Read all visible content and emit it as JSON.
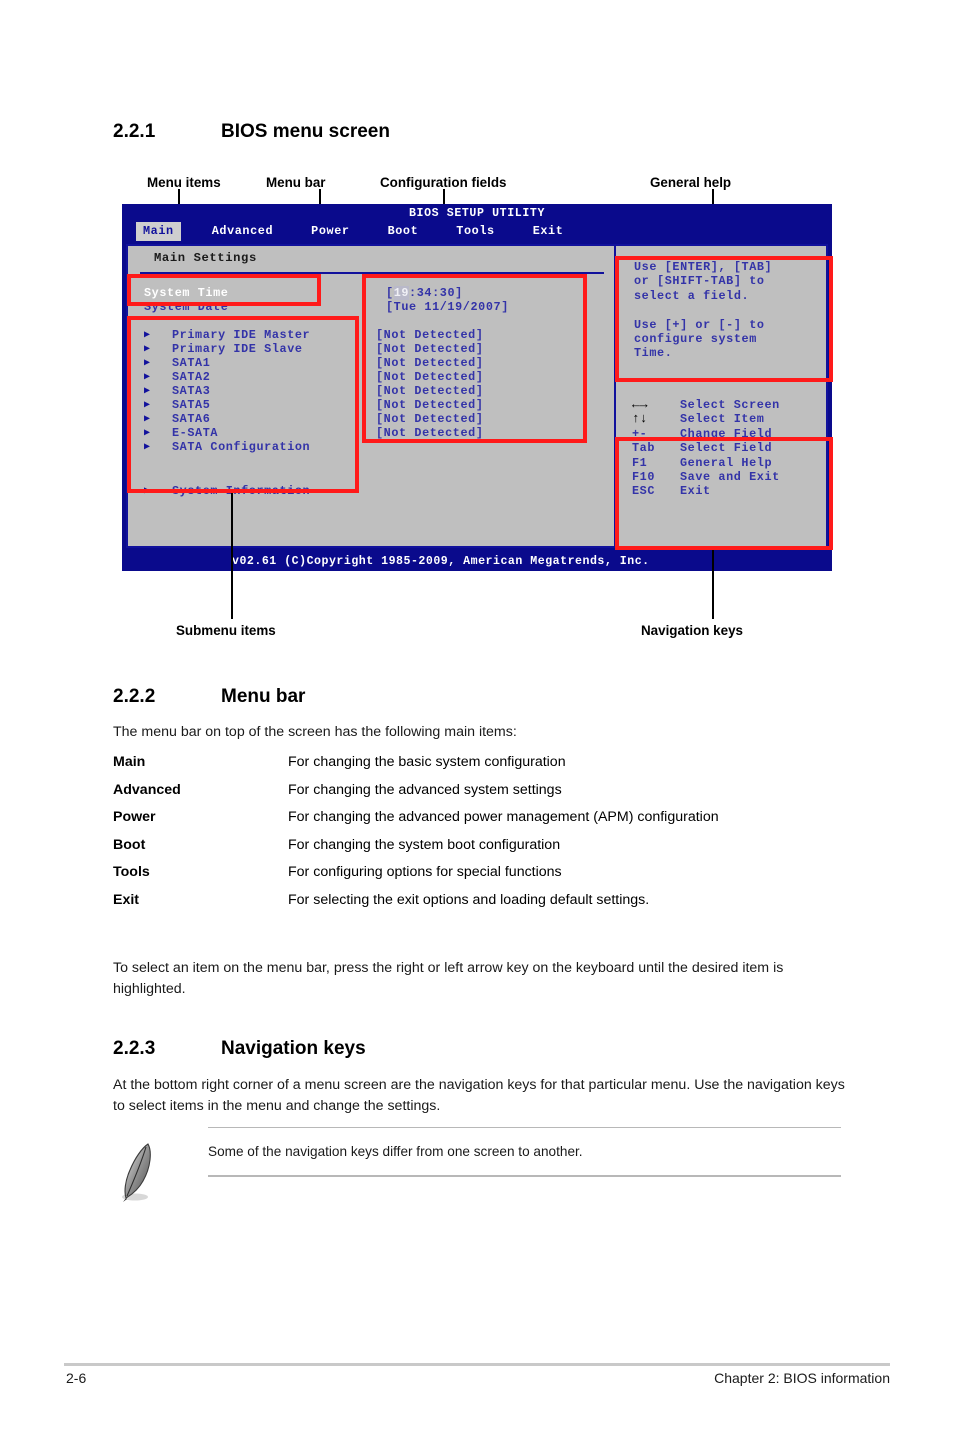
{
  "section_1": {
    "number": "2.2.1",
    "title": "BIOS menu screen"
  },
  "figure": {
    "callouts": {
      "menu_items": "Menu items",
      "menu_bar": "Menu bar",
      "configuration_fields": "Configuration fields",
      "general_help": "General help",
      "submenu_items": "Submenu items",
      "navigation_keys": "Navigation keys"
    },
    "bios": {
      "title": "BIOS SETUP UTILITY",
      "tabs": [
        {
          "label": "Main",
          "active": true
        },
        {
          "label": "Advanced",
          "active": false
        },
        {
          "label": "Power",
          "active": false
        },
        {
          "label": "Boot",
          "active": false
        },
        {
          "label": "Tools",
          "active": false
        },
        {
          "label": "Exit",
          "active": false
        }
      ],
      "settings_title": "Main Settings",
      "rows": [
        {
          "label": "System Time",
          "value_prefix": "[",
          "value_hl": "19",
          "value_suffix": ":34:30]",
          "selected": true,
          "submenu": false
        },
        {
          "label": "System Date",
          "value": "[Tue 11/19/2007]",
          "selected": false,
          "submenu": false
        },
        {
          "label": "Primary IDE Master",
          "value": "[Not Detected]",
          "selected": false,
          "submenu": true
        },
        {
          "label": "Primary IDE Slave",
          "value": "[Not Detected]",
          "selected": false,
          "submenu": true
        },
        {
          "label": "SATA1",
          "value": "[Not Detected]",
          "selected": false,
          "submenu": true
        },
        {
          "label": "SATA2",
          "value": "[Not Detected]",
          "selected": false,
          "submenu": true
        },
        {
          "label": "SATA3",
          "value": "[Not Detected]",
          "selected": false,
          "submenu": true
        },
        {
          "label": "SATA5",
          "value": "[Not Detected]",
          "selected": false,
          "submenu": true
        },
        {
          "label": "SATA6",
          "value": "[Not Detected]",
          "selected": false,
          "submenu": true
        },
        {
          "label": "E-SATA",
          "value": "[Not Detected]",
          "selected": false,
          "submenu": true
        },
        {
          "label": "SATA Configuration",
          "value": "",
          "selected": false,
          "submenu": true
        },
        {
          "label": "System Information",
          "value": "",
          "selected": false,
          "submenu": true
        }
      ],
      "help_text": "Use [ENTER], [TAB]\nor [SHIFT-TAB] to\nselect a field.\n\nUse [+] or [-] to\nconfigure system\nTime.",
      "nav_keys": [
        {
          "key": "←→",
          "glyph": true,
          "desc": "Select Screen"
        },
        {
          "key": "↑↓",
          "glyph": true,
          "desc": "Select Item"
        },
        {
          "key": "+-",
          "glyph": false,
          "desc": "Change Field"
        },
        {
          "key": "Tab",
          "glyph": false,
          "desc": "Select Field"
        },
        {
          "key": "F1",
          "glyph": false,
          "desc": "General Help"
        },
        {
          "key": "F10",
          "glyph": false,
          "desc": "Save and Exit"
        },
        {
          "key": "ESC",
          "glyph": false,
          "desc": "Exit"
        }
      ],
      "footer": "v02.61 (C)Copyright 1985-2009, American Megatrends, Inc."
    }
  },
  "section_2": {
    "number": "2.2.2",
    "title": "Menu bar",
    "intro": "The menu bar on top of the screen has the following main items:",
    "items": [
      {
        "term": "Main",
        "desc": "For changing the basic system configuration"
      },
      {
        "term": "Advanced",
        "desc": "For changing the advanced system settings"
      },
      {
        "term": "Power",
        "desc": "For changing the advanced power management (APM) configuration"
      },
      {
        "term": "Boot",
        "desc": "For changing the system boot configuration"
      },
      {
        "term": "Tools",
        "desc": "For configuring options for special functions"
      },
      {
        "term": "Exit",
        "desc": "For selecting the exit options and loading default settings."
      }
    ],
    "outro": "To select an item on the menu bar, press the right or left arrow key on the keyboard until the desired item is highlighted."
  },
  "section_3": {
    "number": "2.2.3",
    "title": "Navigation keys",
    "body": "At the bottom right corner of a menu screen are the navigation keys for that particular menu. Use the navigation keys to select items in the menu and change the settings.",
    "note": "Some of the navigation keys differ from one screen to another."
  },
  "page_footer": {
    "left": "2-6",
    "right": "Chapter 2: BIOS information"
  },
  "colors": {
    "bios_blue": "#0a0a8c",
    "bios_panel": "#bfbfbf",
    "bios_text": "#3333a8",
    "annotation_red": "#ff1a1a"
  }
}
